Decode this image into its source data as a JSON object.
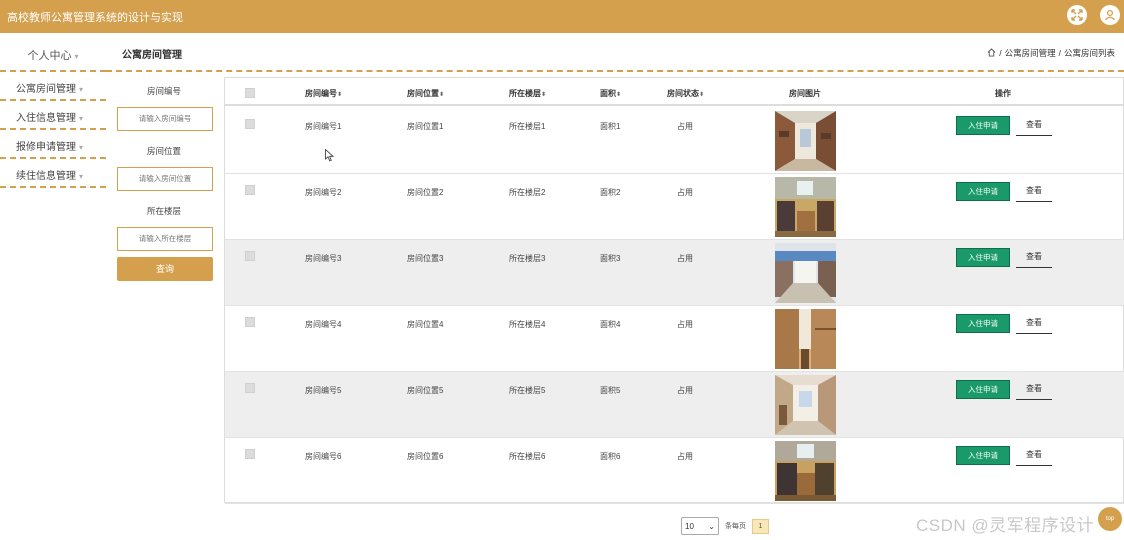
{
  "app": {
    "title": "高校教师公寓管理系统的设计与实现"
  },
  "header_icons": [
    "expand-icon",
    "user-icon"
  ],
  "sidebar": {
    "top": "个人中心",
    "items": [
      {
        "label": "公寓房间管理"
      },
      {
        "label": "入住信息管理"
      },
      {
        "label": "报修申请管理"
      },
      {
        "label": "续住信息管理"
      }
    ]
  },
  "page": {
    "title": "公寓房间管理",
    "breadcrumb": [
      "公寓房间管理",
      "公寓房间列表"
    ],
    "breadcrumb_sep": "/"
  },
  "search": {
    "fields": [
      {
        "label": "房间编号",
        "placeholder": "请输入房间编号"
      },
      {
        "label": "房间位置",
        "placeholder": "请输入房间位置"
      },
      {
        "label": "所在楼层",
        "placeholder": "请输入所在楼层"
      }
    ],
    "button": "查询"
  },
  "table": {
    "columns": [
      "房间编号",
      "房间位置",
      "所在楼层",
      "面积",
      "房间状态",
      "房间图片",
      "操作"
    ],
    "rows": [
      {
        "code": "房间编号1",
        "location": "房间位置1",
        "floor": "所在楼层1",
        "area": "面积1",
        "status": "占用"
      },
      {
        "code": "房间编号2",
        "location": "房间位置2",
        "floor": "所在楼层2",
        "area": "面积2",
        "status": "占用"
      },
      {
        "code": "房间编号3",
        "location": "房间位置3",
        "floor": "所在楼层3",
        "area": "面积3",
        "status": "占用"
      },
      {
        "code": "房间编号4",
        "location": "房间位置4",
        "floor": "所在楼层4",
        "area": "面积4",
        "status": "占用"
      },
      {
        "code": "房间编号5",
        "location": "房间位置5",
        "floor": "所在楼层5",
        "area": "面积5",
        "status": "占用"
      },
      {
        "code": "房间编号6",
        "location": "房间位置6",
        "floor": "所在楼层6",
        "area": "面积6",
        "status": "占用"
      }
    ],
    "actions": {
      "apply": "入住申请",
      "view": "查看"
    }
  },
  "pagination": {
    "page_size": "10",
    "per_page_label": "条每页",
    "current_page": "1"
  },
  "watermark": "CSDN @灵军程序设计",
  "top_button": "top",
  "colors": {
    "accent": "#d4a04e",
    "apply_button": "#1a9a6a"
  }
}
